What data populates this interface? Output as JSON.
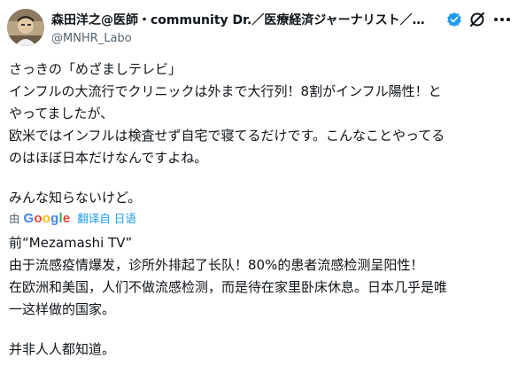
{
  "author": {
    "display_name": "森田洋之@医師・community Dr.／医療経済ジャーナリスト／…",
    "handle": "@MNHR_Labo",
    "avatar_icon": "avatar-photo",
    "verified_icon": "verified-badge-icon",
    "grok_icon": "grok-icon",
    "more_icon": "more-icon"
  },
  "tweet_text": [
    "さっきの「めざましテレビ」",
    "インフルの大流行でクリニックは外まで大行列！8割がインフル陽性！と",
    "やってましたが、",
    "欧米ではインフルは検査せず自宅で寝てるだけです。こんなことやってる",
    "のはほぼ日本だけなんですよね。",
    "",
    "みんな知らないけど。"
  ],
  "translate_bar": {
    "by_label": "由",
    "google_logo": "Google",
    "link_label": "翻译自 日语"
  },
  "translation_text": [
    "前“Mezamashi TV”",
    "由于流感疫情爆发，诊所外排起了长队！80%的患者流感检测呈阳性！",
    "在欧洲和美国，人们不做流感检测，而是待在家里卧床休息。日本几乎是唯",
    "一这样做的国家。",
    "",
    "并非人人都知道。"
  ],
  "colors": {
    "text": "#0f1419",
    "secondary": "#536471",
    "accent": "#1d9bf0"
  }
}
